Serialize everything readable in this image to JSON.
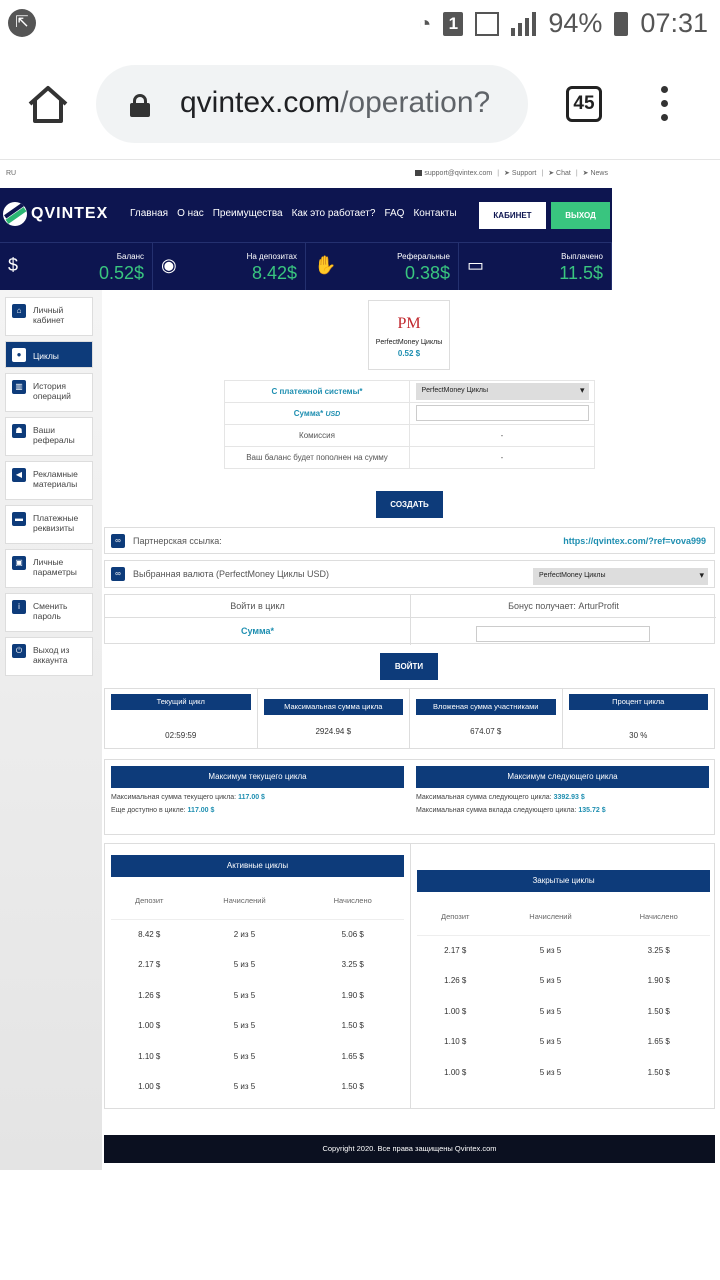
{
  "status_bar": {
    "battery": "94%",
    "time": "07:31",
    "sim": "1"
  },
  "browser": {
    "url_domain": "qvintex.com",
    "url_path": "/operation?",
    "tab_count": "45"
  },
  "site": {
    "lang": "RU",
    "toplinks": {
      "email": "support@qvintex.com",
      "support": "Support",
      "chat": "Chat",
      "news": "News"
    },
    "logo": "QVINTEX",
    "nav": [
      "Главная",
      "О нас",
      "Преимущества",
      "Как это работает?",
      "FAQ",
      "Контакты"
    ],
    "cabinet_button": "КАБИНЕТ",
    "exit_button": "ВЫХОД",
    "stats": [
      {
        "label": "Баланс",
        "value": "0.52$"
      },
      {
        "label": "На депозитах",
        "value": "8.42$"
      },
      {
        "label": "Реферальные",
        "value": "0.38$"
      },
      {
        "label": "Выплачено",
        "value": "11.5$"
      }
    ],
    "sidebar": [
      {
        "label": "Личный кабинет",
        "icon": "home-icon"
      },
      {
        "label": "Циклы",
        "icon": "cycle-icon",
        "active": true
      },
      {
        "label": "История операций",
        "icon": "chart-icon"
      },
      {
        "label": "Ваши рефералы",
        "icon": "users-icon"
      },
      {
        "label": "Рекламные материалы",
        "icon": "megaphone-icon"
      },
      {
        "label": "Платежные реквизиты",
        "icon": "card-icon"
      },
      {
        "label": "Личные параметры",
        "icon": "id-icon"
      },
      {
        "label": "Сменить пароль",
        "icon": "info-icon"
      },
      {
        "label": "Выход из аккаунта",
        "icon": "power-icon"
      }
    ],
    "wallet_card": {
      "logo": "PM",
      "name": "PerfectMoney Циклы",
      "balance": "0.52 $"
    },
    "form": {
      "payment_system_label": "С платежной системы*",
      "payment_system_value": "PerfectMoney Циклы",
      "amount_label": "Сумма*",
      "amount_unit": "USD",
      "commission_label": "Комиссия",
      "commission_value": "-",
      "total_label": "Ваш баланс будет пополнен на сумму",
      "total_value": "-",
      "create_button": "СОЗДАТЬ"
    },
    "ref_label": "Партнерская ссылка:",
    "ref_link": "https://qvintex.com/?ref=vova999",
    "currency_label": "Выбранная валюта (PerfectMoney Циклы USD)",
    "currency_value": "PerfectMoney Циклы",
    "cycle_join": {
      "title": "Войти в цикл",
      "bonus": "Бонус получает: ArturProfit",
      "amount_label": "Сумма*",
      "button": "ВОЙТИ"
    },
    "info": [
      {
        "header": "Текущий цикл",
        "value": "02:59:59"
      },
      {
        "header": "Максимальная сумма цикла",
        "value": "2924.94 $"
      },
      {
        "header": "Вложеная сумма участниками",
        "value": "674.07 $"
      },
      {
        "header": "Процент цикла",
        "value": "30 %"
      }
    ],
    "max_current": {
      "header": "Максимум текущего цикла",
      "line1_label": "Максимальная сумма текущего цикла:",
      "line1_value": "117.00 $",
      "line2_label": "Еще доступно в цикле:",
      "line2_value": "117.00 $"
    },
    "max_next": {
      "header": "Максимум следующего цикла",
      "line1_label": "Максимальная сумма следующего цикла:",
      "line1_value": "3392.93 $",
      "line2_label": "Максимальная сумма вклада следующего цикла:",
      "line2_value": "135.72 $"
    },
    "active_cycles": {
      "header": "Активные циклы",
      "columns": [
        "Депозит",
        "Начислений",
        "Начислено"
      ],
      "rows": [
        [
          "8.42 $",
          "2 из 5",
          "5.06 $"
        ],
        [
          "2.17 $",
          "5 из 5",
          "3.25 $"
        ],
        [
          "1.26 $",
          "5 из 5",
          "1.90 $"
        ],
        [
          "1.00 $",
          "5 из 5",
          "1.50 $"
        ],
        [
          "1.10 $",
          "5 из 5",
          "1.65 $"
        ],
        [
          "1.00 $",
          "5 из 5",
          "1.50 $"
        ]
      ]
    },
    "closed_cycles": {
      "header": "Закрытые циклы",
      "columns": [
        "Депозит",
        "Начислений",
        "Начислено"
      ],
      "rows": [
        [
          "2.17 $",
          "5 из 5",
          "3.25 $"
        ],
        [
          "1.26 $",
          "5 из 5",
          "1.90 $"
        ],
        [
          "1.00 $",
          "5 из 5",
          "1.50 $"
        ],
        [
          "1.10 $",
          "5 из 5",
          "1.65 $"
        ],
        [
          "1.00 $",
          "5 из 5",
          "1.50 $"
        ]
      ]
    },
    "footer": "Copyright 2020. Все права защищены Qvintex.com"
  }
}
